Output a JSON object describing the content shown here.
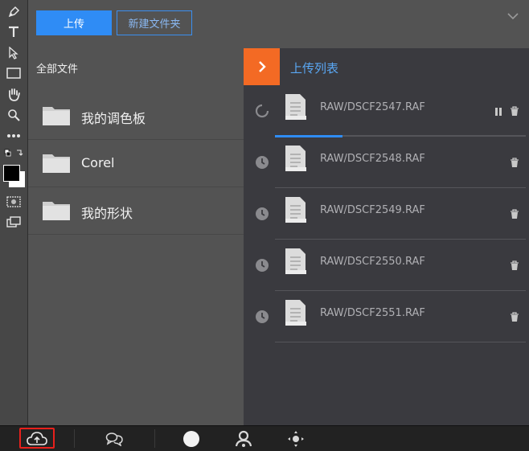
{
  "toolbar": {
    "tools": [
      "pen-tool",
      "text-tool",
      "select-tool",
      "rectangle-tool",
      "hand-tool",
      "zoom-tool",
      "more-tool",
      "swap-colors",
      "color-swatches",
      "quick-mask",
      "screen-mode"
    ],
    "foreground_color": "#000000",
    "background_color": "#ffffff"
  },
  "header": {
    "upload_label": "上传",
    "new_folder_label": "新建文件夹"
  },
  "files": {
    "title": "全部文件",
    "folders": [
      {
        "name": "我的调色板"
      },
      {
        "name": "Corel"
      },
      {
        "name": "我的形状"
      }
    ]
  },
  "upload_list": {
    "title": "上传列表",
    "items": [
      {
        "name": "RAW/DSCF2547.RAF",
        "status": "uploading",
        "progress": 0.27
      },
      {
        "name": "RAW/DSCF2548.RAF",
        "status": "queued"
      },
      {
        "name": "RAW/DSCF2549.RAF",
        "status": "queued"
      },
      {
        "name": "RAW/DSCF2550.RAF",
        "status": "queued"
      },
      {
        "name": "RAW/DSCF2551.RAF",
        "status": "queued"
      }
    ]
  },
  "bottom_bar": {
    "items": [
      "cloud-upload-icon",
      "chat-icon",
      "circle-icon",
      "user-settings-icon",
      "move-icon"
    ]
  },
  "colors": {
    "accent": "#2f8cf5",
    "orange": "#f36a24",
    "highlight": "#e8201c"
  }
}
